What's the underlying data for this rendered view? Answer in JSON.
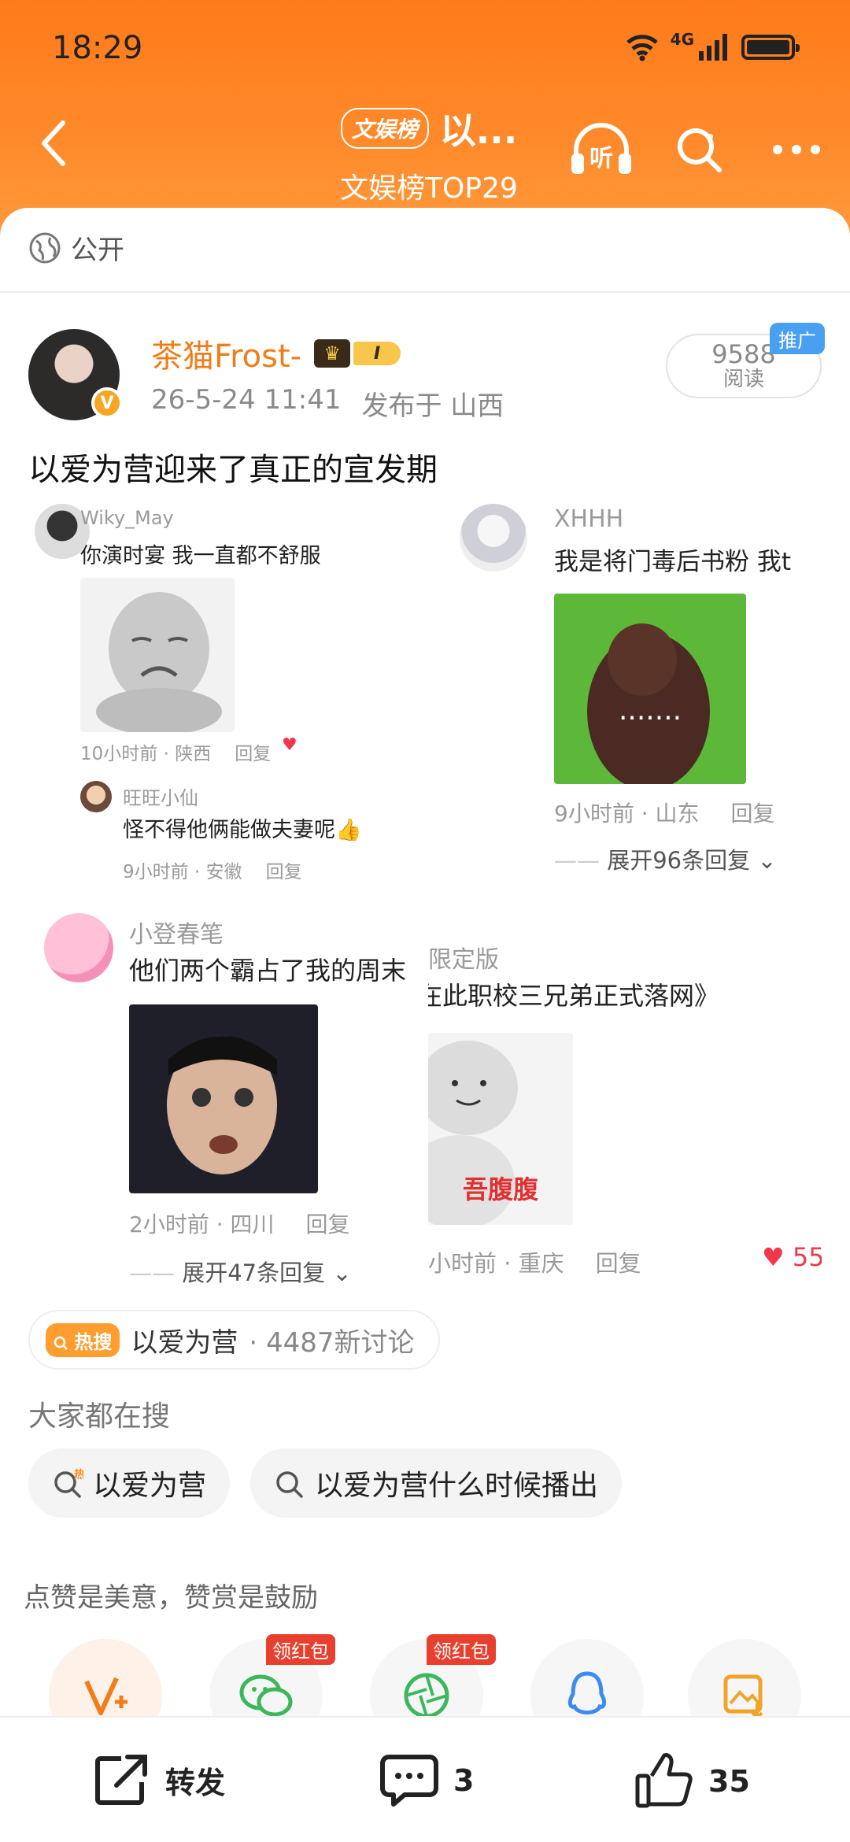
{
  "status_bar": {
    "time": "18:29",
    "network": "4G"
  },
  "nav": {
    "badge": "文娱榜",
    "title": "以...",
    "subtitle": "文娱榜TOP29"
  },
  "visibility": {
    "label": "公开"
  },
  "post": {
    "author": "茶猫Frost-",
    "level": "I",
    "time": "26-5-24 11:41",
    "location": "发布于 山西",
    "reads": "9588",
    "reads_label": "阅读",
    "ad_tag": "推广",
    "text": "以爱为营迎来了真正的宣发期"
  },
  "collage": {
    "c1": {
      "name": "Wiky_May",
      "text": "你演时宴 我一直都不舒服",
      "time": "10小时前 · 陕西",
      "reply": "回复"
    },
    "c1r": {
      "name": "旺旺小仙",
      "text": "怪不得他俩能做夫妻呢👍",
      "time": "9小时前 · 安徽",
      "reply": "回复"
    },
    "c2": {
      "name": "XHHH",
      "text": "我是将门毒后书粉 我t",
      "meme_text": ".......",
      "time": "9小时前 · 山东",
      "reply": "回复",
      "expand": "展开96条回复"
    },
    "c3": {
      "name": "小登春笔",
      "text": "他们两个霸占了我的周末",
      "time": "2小时前 · 四川",
      "reply": "回复",
      "expand": "展开47条回复"
    },
    "c4": {
      "name": "限定版",
      "text": "在此职校三兄弟正式落网》",
      "meme_text": "吾腹腹",
      "time": "小时前 · 重庆",
      "reply": "回复",
      "likes": "55"
    }
  },
  "hot_search": {
    "tag": "热搜",
    "keyword": "以爱为营",
    "count": "· 4487新讨论"
  },
  "everyone_search": {
    "title": "大家都在搜",
    "chips": [
      "以爱为营",
      "以爱为营什么时候播出"
    ]
  },
  "reward": {
    "note": "点赞是美意，赞赏是鼓励",
    "redpack_label": "领红包"
  },
  "bottom_bar": {
    "repost": "转发",
    "comments": "3",
    "likes": "35"
  },
  "colors": {
    "brand_orange": "#ff7a1a",
    "author_orange": "#f07d1a",
    "hot": "#ff9d2e"
  }
}
